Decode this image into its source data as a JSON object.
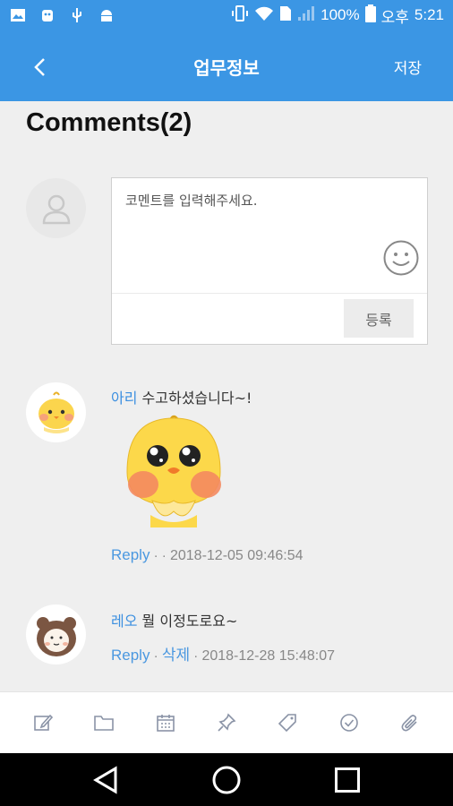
{
  "status_bar": {
    "battery": "100%",
    "ampm": "오후",
    "time": "5:21"
  },
  "app_bar": {
    "title": "업무정보",
    "save_label": "저장"
  },
  "comments": {
    "heading": "Comments(2)",
    "compose": {
      "placeholder": "코멘트를 입력해주세요.",
      "submit_label": "등록"
    },
    "items": [
      {
        "author": "아리",
        "text": "수고하셨습니다~!",
        "has_sticker": true,
        "reply_label": "Reply",
        "separator": " · · ",
        "date": "2018-12-05 09:46:54"
      },
      {
        "author": "레오",
        "text": "뭘 이정도로요~",
        "has_sticker": false,
        "reply_label": "Reply",
        "delete_label": "삭제",
        "date": "2018-12-28 15:48:07"
      }
    ]
  },
  "toolbar": {
    "icons": [
      "edit-icon",
      "folder-icon",
      "calendar-icon",
      "pin-icon",
      "tag-icon",
      "check-circle-icon",
      "attach-icon"
    ]
  },
  "colors": {
    "primary": "#3b96e4",
    "link": "#4b98e0",
    "background": "#efefef"
  }
}
